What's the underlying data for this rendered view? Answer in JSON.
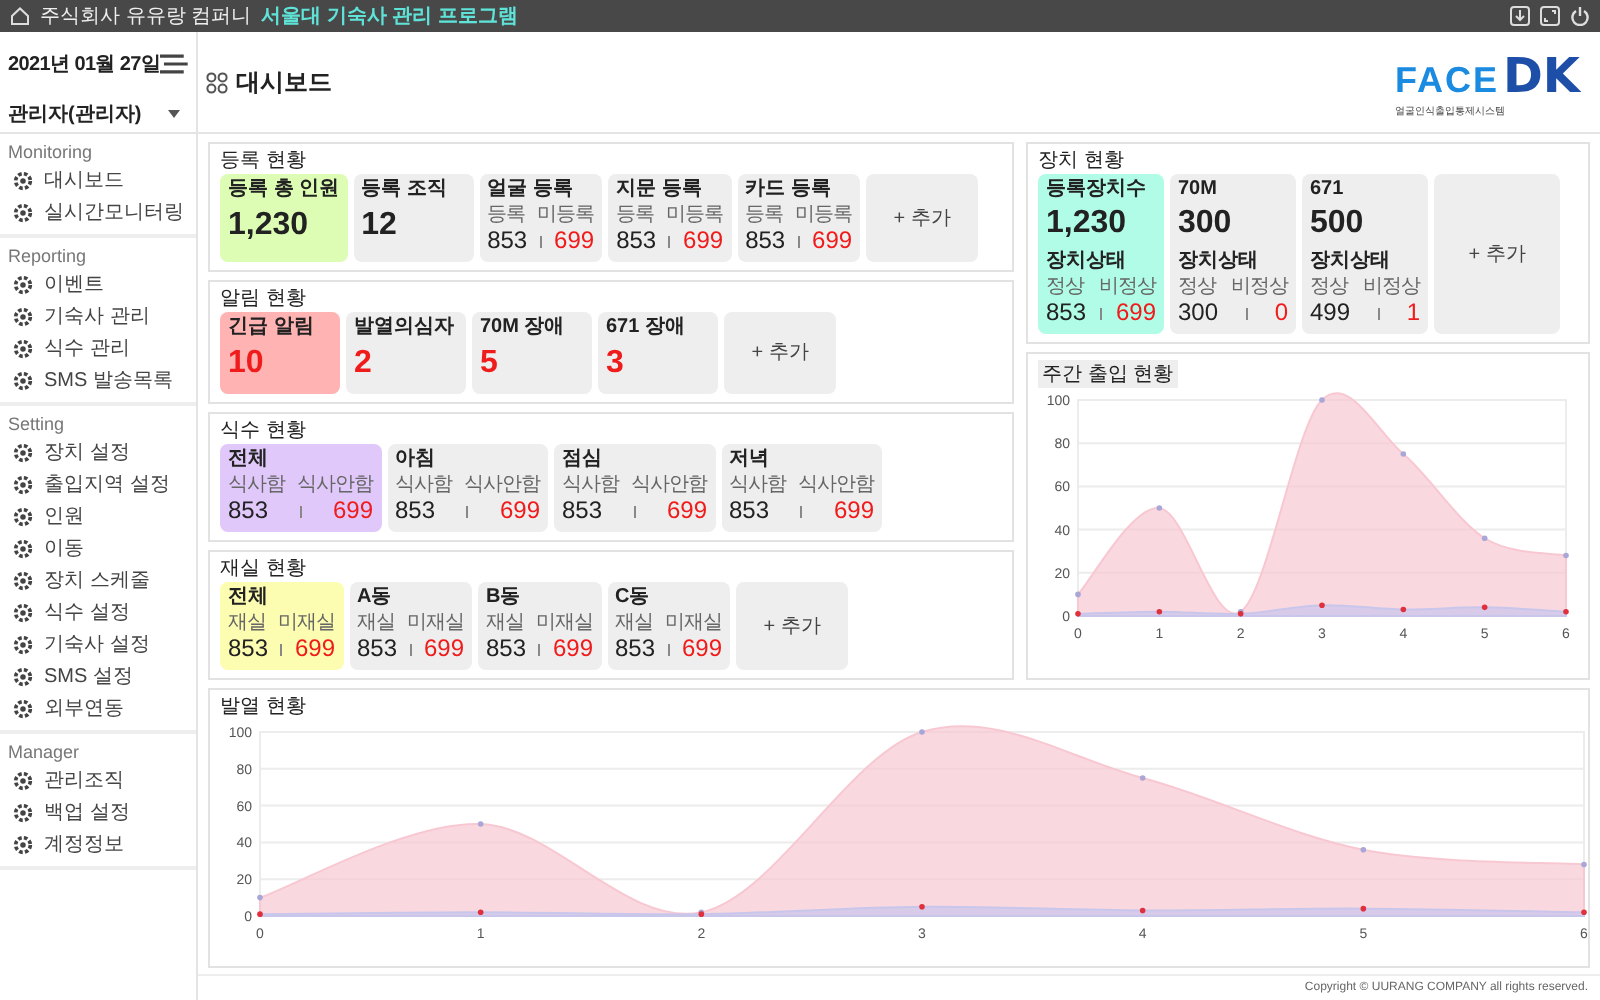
{
  "topbar": {
    "company": "주식회사 유유랑 컴퍼니",
    "program": "서울대 기숙사 관리 프로그램"
  },
  "date": "2021년 01월 27일",
  "user": "관리자(관리자)",
  "page_title": "대시보드",
  "logo": {
    "main": "FACE",
    "accent": "DK",
    "subtitle": "얼굴인식출입통제시스템"
  },
  "sidebar": [
    {
      "title": "Monitoring",
      "items": [
        "대시보드",
        "실시간모니터링"
      ]
    },
    {
      "title": "Reporting",
      "items": [
        "이벤트",
        "기숙사 관리",
        "식수 관리",
        "SMS 발송목록"
      ]
    },
    {
      "title": "Setting",
      "items": [
        "장치 설정",
        "출입지역 설정",
        "인원",
        "이동",
        "장치 스케줄",
        "식수 설정",
        "기숙사 설정",
        "SMS 설정",
        "외부연동"
      ]
    },
    {
      "title": "Manager",
      "items": [
        "관리조직",
        "백업 설정",
        "계정정보"
      ]
    }
  ],
  "panels": [
    {
      "title": "등록 현황",
      "cards": [
        {
          "kind": "count",
          "title": "등록 총 인원",
          "value": "1,230",
          "color": "#ddfcb4"
        },
        {
          "kind": "count",
          "title": "등록 조직",
          "value": "12",
          "color": "#eeeeee"
        },
        {
          "kind": "split",
          "title": "얼굴 등록",
          "labels": [
            "등록",
            "미등록"
          ],
          "values": [
            "853",
            "699"
          ],
          "color": "#eeeeee"
        },
        {
          "kind": "split",
          "title": "지문 등록",
          "labels": [
            "등록",
            "미등록"
          ],
          "values": [
            "853",
            "699"
          ],
          "color": "#eeeeee"
        },
        {
          "kind": "split",
          "title": "카드 등록",
          "labels": [
            "등록",
            "미등록"
          ],
          "values": [
            "853",
            "699"
          ],
          "color": "#eeeeee"
        },
        {
          "kind": "add",
          "title": "+ 추가",
          "color": "#eeeeee"
        }
      ]
    },
    {
      "title": "알림 현황",
      "cards": [
        {
          "kind": "alert",
          "title": "긴급 알림",
          "value": "10",
          "color": "#ffb3b3"
        },
        {
          "kind": "alert",
          "title": "발열의심자",
          "value": "2",
          "color": "#eeeeee"
        },
        {
          "kind": "alert",
          "title": "70M 장애",
          "value": "5",
          "color": "#eeeeee"
        },
        {
          "kind": "alert",
          "title": "671 장애",
          "value": "3",
          "color": "#eeeeee"
        },
        {
          "kind": "add",
          "title": "+ 추가",
          "color": "#eeeeee"
        }
      ]
    },
    {
      "title": "식수 현황",
      "cards": [
        {
          "kind": "split",
          "title": "전체",
          "labels": [
            "식사함",
            "식사안함"
          ],
          "values": [
            "853",
            "699"
          ],
          "color": "#e0c8fa"
        },
        {
          "kind": "split",
          "title": "아침",
          "labels": [
            "식사함",
            "식사안함"
          ],
          "values": [
            "853",
            "699"
          ],
          "color": "#eeeeee"
        },
        {
          "kind": "split",
          "title": "점심",
          "labels": [
            "식사함",
            "식사안함"
          ],
          "values": [
            "853",
            "699"
          ],
          "color": "#eeeeee"
        },
        {
          "kind": "split",
          "title": "저녁",
          "labels": [
            "식사함",
            "식사안함"
          ],
          "values": [
            "853",
            "699"
          ],
          "color": "#eeeeee"
        }
      ]
    },
    {
      "title": "재실 현황",
      "cards": [
        {
          "kind": "split",
          "title": "전체",
          "labels": [
            "재실",
            "미재실"
          ],
          "values": [
            "853",
            "699"
          ],
          "color": "#fdfdb2"
        },
        {
          "kind": "split",
          "title": "A동",
          "labels": [
            "재실",
            "미재실"
          ],
          "values": [
            "853",
            "699"
          ],
          "color": "#eeeeee"
        },
        {
          "kind": "split",
          "title": "B동",
          "labels": [
            "재실",
            "미재실"
          ],
          "values": [
            "853",
            "699"
          ],
          "color": "#eeeeee"
        },
        {
          "kind": "split",
          "title": "C동",
          "labels": [
            "재실",
            "미재실"
          ],
          "values": [
            "853",
            "699"
          ],
          "color": "#eeeeee"
        },
        {
          "kind": "add",
          "title": "+ 추가",
          "color": "#eeeeee"
        }
      ]
    }
  ],
  "devices": {
    "title": "장치 현황",
    "cards": [
      {
        "kind": "device",
        "title": "등록장치수",
        "value": "1,230",
        "status": "장치상태",
        "labels": [
          "정상",
          "비정상"
        ],
        "values": [
          "853",
          "699"
        ],
        "color": "#b0fce6"
      },
      {
        "kind": "device",
        "title": "70M",
        "value": "300",
        "status": "장치상태",
        "labels": [
          "정상",
          "비정상"
        ],
        "values": [
          "300",
          "0"
        ],
        "color": "#eeeeee"
      },
      {
        "kind": "device",
        "title": "671",
        "value": "500",
        "status": "장치상태",
        "labels": [
          "정상",
          "비정상"
        ],
        "values": [
          "499",
          "1"
        ],
        "color": "#eeeeee"
      },
      {
        "kind": "add",
        "title": "+ 추가",
        "color": "#eeeeee"
      }
    ]
  },
  "weekly": {
    "chart_data": {
      "type": "area",
      "title": "주간 출입 현황",
      "grid": true,
      "xlim": [
        0,
        6
      ],
      "x": [
        0,
        1,
        2,
        3,
        4,
        5,
        6
      ],
      "xticks": [
        0,
        1,
        2,
        3,
        4,
        5,
        6
      ],
      "yticks": [
        0,
        20,
        40,
        60,
        80,
        100
      ],
      "ylim": [
        0,
        100
      ],
      "series": [
        {
          "color": "#f8c8d2",
          "values": [
            10,
            50,
            2,
            100,
            75,
            36,
            28
          ]
        },
        {
          "color": "#c9c6ec",
          "values": [
            1,
            2,
            1,
            5,
            3,
            4,
            2
          ]
        }
      ]
    }
  },
  "fever": {
    "chart_data": {
      "type": "area",
      "title": "발열 현황",
      "grid": true,
      "xlim": [
        0,
        6
      ],
      "x": [
        0,
        1,
        2,
        3,
        4,
        5,
        6
      ],
      "xticks": [
        0,
        1,
        2,
        3,
        4,
        5,
        6
      ],
      "yticks": [
        0,
        20,
        40,
        60,
        80,
        100
      ],
      "ylim": [
        0,
        100
      ],
      "series": [
        {
          "color": "#f8c8d2",
          "values": [
            10,
            50,
            2,
            100,
            75,
            36,
            28
          ]
        },
        {
          "color": "#c9c6ec",
          "values": [
            1,
            2,
            1,
            5,
            3,
            4,
            2
          ]
        }
      ]
    }
  },
  "footer": "Copyright © UURANG COMPANY all rights reserved."
}
